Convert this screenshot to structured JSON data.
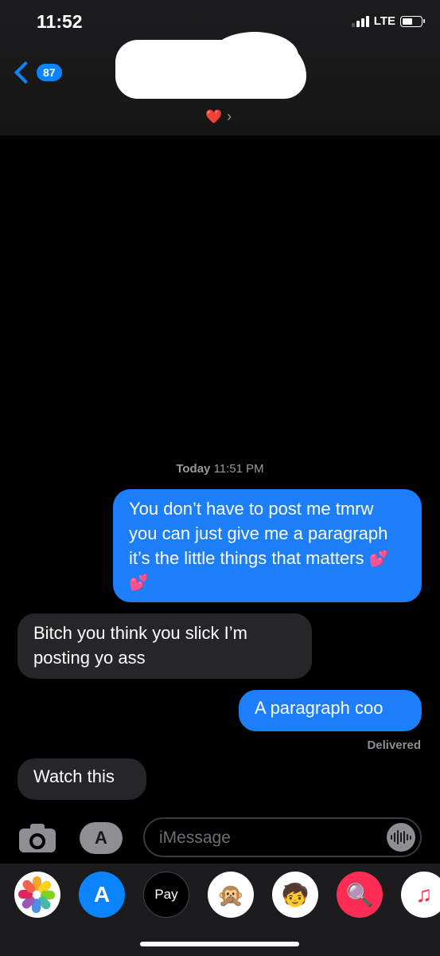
{
  "status_bar": {
    "time": "11:52",
    "network": "LTE"
  },
  "header": {
    "back_count": "87",
    "heart": "❤️",
    "chevron": "›"
  },
  "conversation": {
    "timestamp_day": "Today",
    "timestamp_time": "11:51 PM",
    "messages": [
      {
        "direction": "outgoing",
        "text": "You don’t have to post me tmrw you can just give me a paragraph it’s the little things that matters",
        "emoji": "💕 💕"
      },
      {
        "direction": "incoming",
        "text": "Bitch you think you slick I’m posting yo ass"
      },
      {
        "direction": "outgoing",
        "text": "A paragraph coo"
      },
      {
        "direction": "incoming",
        "text": "Watch this"
      }
    ],
    "delivery_status": "Delivered"
  },
  "composer": {
    "placeholder": "iMessage",
    "appstore_glyph": "A"
  },
  "app_tray": {
    "apps": [
      {
        "name": "photos",
        "glyph": ""
      },
      {
        "name": "app-store",
        "glyph": "A"
      },
      {
        "name": "apple-pay",
        "glyph": "Pay"
      },
      {
        "name": "animoji",
        "glyph": "🙊"
      },
      {
        "name": "memoji",
        "glyph": "🧒"
      },
      {
        "name": "web-search",
        "glyph": "🔍"
      },
      {
        "name": "music",
        "glyph": "♫"
      }
    ]
  },
  "colors": {
    "outgoing": "#1c7ef8",
    "incoming": "#262628",
    "accent": "#0a84ff"
  }
}
